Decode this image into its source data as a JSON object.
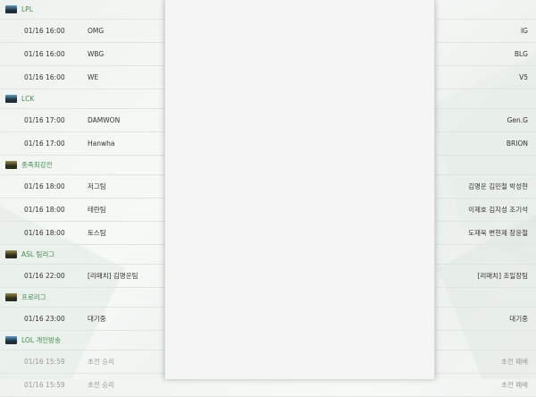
{
  "groups": [
    {
      "league": "LPL",
      "flag": "lpl-flag-icon",
      "flag_colors": [
        "#1f2e3a",
        "#5fa0c8"
      ],
      "matches": [
        {
          "time": "01/16 16:00",
          "home": "OMG",
          "away": "IG"
        },
        {
          "time": "01/16 16:00",
          "home": "WBG",
          "away": "BLG"
        },
        {
          "time": "01/16 16:00",
          "home": "WE",
          "away": "V5"
        }
      ]
    },
    {
      "league": "LCK",
      "flag": "lck-flag-icon",
      "flag_colors": [
        "#1f2e3a",
        "#5fa0c8"
      ],
      "matches": [
        {
          "time": "01/16 17:00",
          "home": "DAMWON",
          "away": "Gen.G"
        },
        {
          "time": "01/16 17:00",
          "home": "Hanwha",
          "away": "BRION"
        }
      ]
    },
    {
      "league": "종족최강전",
      "flag": "starcraft-flag-icon",
      "flag_colors": [
        "#2a2f1c",
        "#9a8a4a"
      ],
      "matches": [
        {
          "time": "01/16 18:00",
          "home": "저그팀",
          "away": "김명운 김민철 박성현"
        },
        {
          "time": "01/16 18:00",
          "home": "테란팀",
          "away": "이제호 김지성 조기석"
        },
        {
          "time": "01/16 18:00",
          "home": "토스팀",
          "away": "도재욱 변현제 장윤철"
        }
      ]
    },
    {
      "league": "ASL 팀리그",
      "flag": "asl-flag-icon",
      "flag_colors": [
        "#2a2f1c",
        "#9a8a4a"
      ],
      "matches": [
        {
          "time": "01/16 22:00",
          "home": "[리매치] 김명운팀",
          "away": "[리매치] 조일장팀"
        }
      ]
    },
    {
      "league": "프로리그",
      "flag": "proleague-flag-icon",
      "flag_colors": [
        "#2a2f1c",
        "#9a8a4a"
      ],
      "matches": [
        {
          "time": "01/16 23:00",
          "home": "대기중",
          "away": "대기중"
        }
      ]
    },
    {
      "league": "LOL 개인방송",
      "flag": "lol-flag-icon",
      "flag_colors": [
        "#1f2e3a",
        "#5fa0c8"
      ],
      "matches": [
        {
          "time": "01/16 15:59",
          "home": "초전 승리",
          "away": "초전 패배",
          "dim": true
        },
        {
          "time": "01/16 15:59",
          "home": "초전 승리",
          "away": "초전 패배",
          "dim": true
        }
      ]
    }
  ]
}
